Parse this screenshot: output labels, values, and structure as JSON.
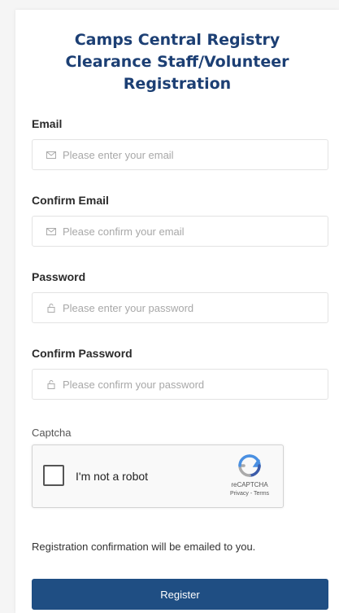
{
  "form": {
    "title_line1": "Camps Central Registry",
    "title_line2": "Clearance Staff/Volunteer",
    "title_line3": "Registration",
    "email": {
      "label": "Email",
      "placeholder": "Please enter your email",
      "icon": "envelope-icon"
    },
    "confirm_email": {
      "label": "Confirm Email",
      "placeholder": "Please confirm your email",
      "icon": "envelope-icon"
    },
    "password": {
      "label": "Password",
      "placeholder": "Please enter your password",
      "icon": "lock-icon"
    },
    "confirm_password": {
      "label": "Confirm Password",
      "placeholder": "Please confirm your password",
      "icon": "lock-icon"
    },
    "captcha": {
      "label": "Captcha",
      "checkbox_text": "I'm not a robot",
      "brand": "reCAPTCHA",
      "privacy": "Privacy - Terms"
    },
    "confirmation_note": "Registration confirmation will be emailed to you.",
    "register_label": "Register"
  },
  "colors": {
    "title": "#1c3f74",
    "button": "#1f4e83",
    "background": "#f5f5f5"
  }
}
